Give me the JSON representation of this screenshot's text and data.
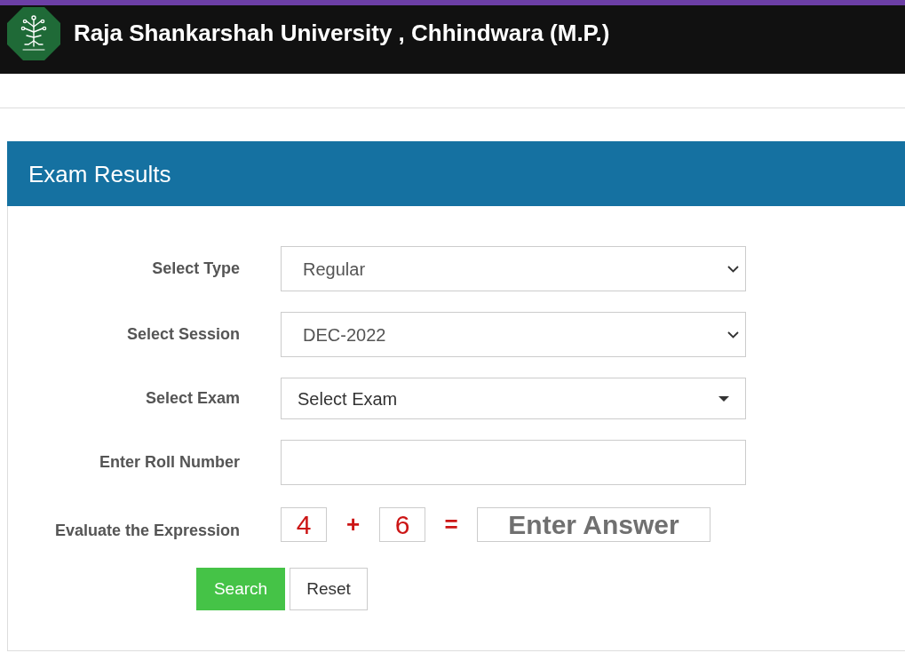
{
  "header": {
    "title": "Raja Shankarshah University , Chhindwara (M.P.)"
  },
  "panel": {
    "title": "Exam Results",
    "fields": [
      {
        "kind": "select",
        "label": "Select Type",
        "value": "Regular"
      },
      {
        "kind": "select",
        "label": "Select Session",
        "value": "DEC-2022"
      },
      {
        "kind": "dropdown",
        "label": "Select Exam",
        "value": "Select Exam"
      },
      {
        "kind": "text",
        "label": "Enter Roll Number"
      },
      {
        "kind": "captcha",
        "label": "Evaluate the Expression",
        "operand_1": "4",
        "operator": "+",
        "operand_2": "6",
        "equals": "=",
        "placeholder": "Enter Answer"
      }
    ],
    "buttons": [
      {
        "kind": "primary",
        "label": "Search"
      },
      {
        "kind": "default",
        "label": "Reset"
      }
    ]
  }
}
